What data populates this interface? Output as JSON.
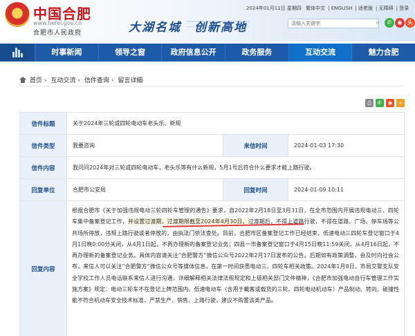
{
  "header": {
    "site_name": "中国合肥",
    "site_url": "www.hefei.gov.cn",
    "site_sub": "合肥市人民政府",
    "slogan": "大湖名城　创新高地",
    "date_text": "2024年01月11日 星期四",
    "top_links": [
      "繁体中文",
      "ENGLISH",
      "适老版",
      "无障碍",
      "登录"
    ],
    "search_placeholder": "请输入关键字",
    "social_icons": [
      "weixin-icon",
      "weibo-icon",
      "toutiao-icon"
    ]
  },
  "nav": {
    "items": [
      "时事新闻",
      "领导之窗",
      "政府信息公开",
      "政务服务",
      "互动交流",
      "魅力合肥"
    ],
    "active_index": 4
  },
  "breadcrumb": [
    "首页",
    "互动交流",
    "信件查询",
    "留言详细"
  ],
  "share_icons": [
    "print-icon",
    "wechat-share-icon",
    "weibo-share-icon",
    "more-share-icon"
  ],
  "letter": {
    "title_label": "信件标题",
    "title_value": "关于2024年三轮或四轮电动车老头乐、新规",
    "type_label": "信件类型",
    "type_value": "我要咨询",
    "date_label": "来信时间",
    "date_value": "2024-01-03 17:30",
    "content_label": "信件内容",
    "content_value": "我问问2024年对三轮或四轮电动车，老头乐等有什么新规，5月1号后符合什么要求才能上路行驶。",
    "unit_label": "回复单位",
    "unit_value": "合肥市公安局",
    "reply_date_label": "回复时间",
    "reply_date_value": "2024-01-09 10:11",
    "reply_label": "回复内容",
    "reply_part1": "根据合肥市《关于加强违规电动三轮四轮车管理的通告》要求，自2022年2月18日至3月31日，在全市范围内开展违规电动三、四轮车集中备案登记工作，",
    "reply_highlight": "并设置过渡期，过渡期限截至2024年4月30日。",
    "reply_part2": "过渡期后，不得上道路行驶，不得在道路、广场、停车场等公共场所停放，违规上路行驶或者停放的，由执法门依法查处。目前，合肥市区备案登记工作已经结束，低速电动三四轮车登记窗口于4月1日晚0:00分关闭，从4月1日起，不再办理新的备案登记业务；四县一市备案登记窗口于4月15日晚11:59关闭，从4月16日起，不再办理新的备案登记业务。具体内容请关注“合肥警方”微信公众号2022年2月17日发布的公告。后期如有政策调整，会及时向社会公布，来信人可以关注“合肥警方”微信公众号等媒体信息，在第一时间获悉电动三、四轮车相关政策。2024年1月8日，市局交警支队安全学校工作人员电话联系来信人进行沟通，详细解释相关法律法规规定和上级相关部门文件精神，《合肥市加强电动自行车管理工作实施方案》规定：电动三轮车不在登记上牌范围内。低速电动车（含用于載客或载货的三轮、四轮电动机动车）产品制动、转向、碰撞性能不符合机动车安全技术标准，严禁生产、销售、上路行驶，建议不购置该类产品。"
  },
  "colors": {
    "brand_red": "#c6161d",
    "nav_blue": "#1d5aa8",
    "nav_active": "#0f6fc9",
    "label_bg": "#eaf1fa",
    "label_text": "#1d4f8e",
    "underline_red": "#e23a3a"
  }
}
